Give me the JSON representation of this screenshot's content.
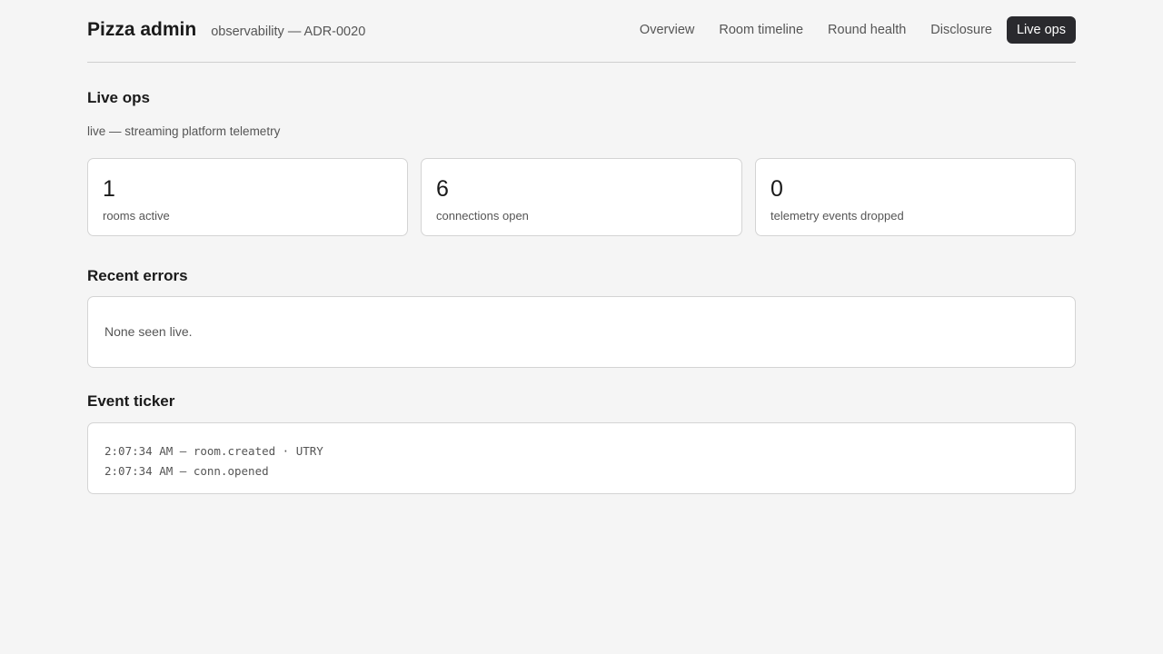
{
  "header": {
    "app_title": "Pizza admin",
    "subtitle": "observability — ADR-0020",
    "nav": [
      {
        "label": "Overview"
      },
      {
        "label": "Room timeline"
      },
      {
        "label": "Round health"
      },
      {
        "label": "Disclosure"
      },
      {
        "label": "Live ops",
        "active": true
      }
    ]
  },
  "page": {
    "title": "Live ops",
    "subtitle": "live — streaming platform telemetry"
  },
  "stats": [
    {
      "value": "1",
      "label": "rooms active"
    },
    {
      "value": "6",
      "label": "connections open"
    },
    {
      "value": "0",
      "label": "telemetry events dropped"
    }
  ],
  "errors": {
    "title": "Recent errors",
    "empty_text": "None seen live."
  },
  "ticker": {
    "title": "Event ticker",
    "events": [
      "2:07:34 AM — room.created · UTRY",
      "2:07:34 AM — conn.opened"
    ]
  },
  "colors": {
    "background": "#f5f5f5",
    "active_tab": "#2a2a2e",
    "card_border": "#d4d4d4"
  }
}
